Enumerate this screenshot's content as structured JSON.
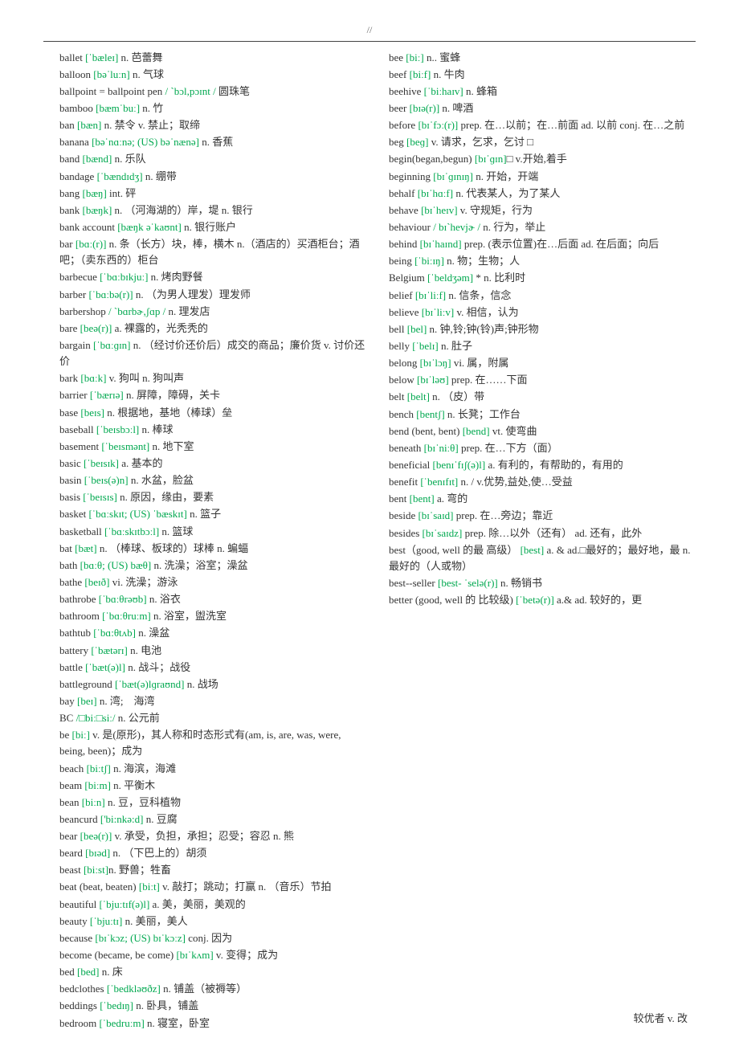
{
  "header": "//",
  "footer_right": "较优者 v. 改",
  "left": [
    {
      "w": "ballet",
      "p": "[ˈbæleɪ]",
      "d": " n. 芭蕾舞"
    },
    {
      "w": "balloon",
      "p": "[bəˈluːn]",
      "d": " n. 气球"
    },
    {
      "w": "ballpoint = ballpoint pen",
      "p": "/ ˋbɔl,pɔɪnt /",
      "d": " 圆珠笔"
    },
    {
      "w": "bamboo",
      "p": "[bæmˈbuː]",
      "d": " n. 竹"
    },
    {
      "w": "ban",
      "p": "[bæn]",
      "d": " n. 禁令 v. 禁止；取缔"
    },
    {
      "w": "banana",
      "p": "[bəˈnɑːnə; (US) bəˈnænə]",
      "d": " n. 香蕉"
    },
    {
      "w": "band",
      "p": "[bænd]",
      "d": " n. 乐队"
    },
    {
      "w": "bandage",
      "p": "[ˈbændɪdʒ]",
      "d": " n. 绷带"
    },
    {
      "w": "bang",
      "p": "[bæŋ]",
      "d": " int. 砰"
    },
    {
      "w": "bank",
      "p": "[bæŋk]",
      "d": " n. （河海湖的）岸，堤  n. 银行"
    },
    {
      "w": "bank account",
      "p": "[bæŋk əˈkaʊnt]",
      "d": " n. 银行账户"
    },
    {
      "w": "bar",
      "p": "[bɑː(r)]",
      "d": " n. 条（长方）块，棒，横木  n.（酒店的）买酒柜台；酒吧；（卖东西的）柜台"
    },
    {
      "w": "barbecue",
      "p": "[ˈbɑːbɪkjuː]",
      "d": " n. 烤肉野餐"
    },
    {
      "w": "barber",
      "p": "[ˈbɑːbə(r)]",
      "d": " n. （为男人理发）理发师"
    },
    {
      "w": "barbershop",
      "p": "/ ˋbɑrbɚ,ʃɑp /",
      "d": " n. 理发店"
    },
    {
      "w": "bare",
      "p": "[beə(r)]",
      "d": " a. 裸露的，光秃秃的"
    },
    {
      "w": "bargain",
      "p": "[ˈbɑːɡɪn]",
      "d": " n. （经讨价还价后）成交的商品；廉价货 v. 讨价还价"
    },
    {
      "w": "bark",
      "p": "[bɑːk]",
      "d": " v. 狗叫  n. 狗叫声"
    },
    {
      "w": "barrier",
      "p": "[ˈbærɪə]",
      "d": " n. 屏障，障碍，关卡"
    },
    {
      "w": "base",
      "p": "[beɪs]",
      "d": " n. 根据地，基地（棒球）垒"
    },
    {
      "w": "baseball",
      "p": "[ˈbeɪsbɔːl]",
      "d": " n. 棒球"
    },
    {
      "w": "basement",
      "p": "[ˈbeɪsmənt]",
      "d": " n. 地下室"
    },
    {
      "w": "basic",
      "p": "[ˈbeɪsɪk]",
      "d": " a. 基本的"
    },
    {
      "w": "basin",
      "p": "[ˈbeɪs(ə)n]",
      "d": " n. 水盆，脸盆"
    },
    {
      "w": "basis",
      "p": "[ˈbeɪsɪs]",
      "d": " n. 原因，缘由，要素"
    },
    {
      "w": "basket",
      "p": "[ˈbɑːskɪt; (US) ˈbæskɪt]",
      "d": " n. 篮子"
    },
    {
      "w": "basketball",
      "p": "[ˈbɑːskɪtbɔːl]",
      "d": " n. 篮球"
    },
    {
      "w": "bat",
      "p": "[bæt]",
      "d": " n. （棒球、板球的）球棒  n. 蝙蝠"
    },
    {
      "w": "bath",
      "p": "[bɑːθ; (US) bæθ]",
      "d": " n. 洗澡；浴室；澡盆"
    },
    {
      "w": "bathe",
      "p": "[beɪð]",
      "d": " vi. 洗澡；游泳"
    },
    {
      "w": "bathrobe",
      "p": "[ˈbɑːθrəʊb]",
      "d": " n. 浴衣"
    },
    {
      "w": "bathroom",
      "p": "[ˈbɑːθruːm]",
      "d": " n. 浴室，盥洗室"
    },
    {
      "w": "bathtub",
      "p": "[ˈbɑ:θtʌb]",
      "d": "    n. 澡盆"
    },
    {
      "w": "battery",
      "p": "[ˈbætərɪ]",
      "d": " n. 电池"
    },
    {
      "w": "battle",
      "p": "[ˈbæt(ə)l]",
      "d": " n. 战斗；战役"
    },
    {
      "w": "battleground",
      "p": "[ˈbæt(ə)lɡraʊnd]",
      "d": " n. 战场"
    },
    {
      "w": "bay",
      "p": "[beɪ]",
      "d": " n. 湾;　海湾"
    },
    {
      "w": "BC",
      "p": "/□biː□siː/",
      "d": " n. 公元前"
    },
    {
      "w": "be",
      "p": "[biː]",
      "d": " v. 是(原形)，其人称和时态形式有(am, is, are, was, were, being, been)；成为"
    },
    {
      "w": "beach",
      "p": "[biːtʃ]",
      "d": " n. 海滨，海滩"
    },
    {
      "w": "beam",
      "p": "[biːm]",
      "d": " n. 平衡木"
    },
    {
      "w": "bean",
      "p": "[biːn]",
      "d": " n. 豆，豆科植物"
    },
    {
      "w": "beancurd",
      "p": "['bi:nkə:d]",
      "d": " n. 豆腐"
    },
    {
      "w": "bear",
      "p": "[beə(r)]",
      "d": " v. 承受，负担，承担；忍受；容忍 n. 熊"
    },
    {
      "w": "beard",
      "p": "[bɪəd]",
      "d": " n. （下巴上的）胡须"
    },
    {
      "w": "beast",
      "p": "[biːst]",
      "d": "n. 野兽；牲畜"
    },
    {
      "w": "beat (beat, beaten)",
      "p": "[biːt]",
      "d": " v. 敲打；跳动；打赢 n. （音乐）节拍"
    },
    {
      "w": "beautiful",
      "p": "[ˈbjuːtɪf(ə)l]",
      "d": " a. 美，美丽，美观的"
    },
    {
      "w": "beauty",
      "p": "[ˈbjuːtɪ]",
      "d": " n. 美丽，美人"
    },
    {
      "w": "because",
      "p": "[bɪˈkɔz; (US) bɪˈkɔːz]",
      "d": " conj. 因为"
    },
    {
      "w": "become (became, be come)",
      "p": "[bɪˈkʌm]",
      "d": " v. 变得；成为"
    },
    {
      "w": "bed",
      "p": "[bed]",
      "d": " n. 床"
    },
    {
      "w": "bedclothes",
      "p": "[ˈbedkləʊðz]",
      "d": " n. 铺盖（被褥等）"
    },
    {
      "w": "beddings",
      "p": "[ˈbedɪŋ]",
      "d": " n. 卧具，铺盖"
    },
    {
      "w": "bedroom",
      "p": "[ˈbedruːm]",
      "d": " n. 寝室，卧室"
    }
  ],
  "right": [
    {
      "w": "bee",
      "p": "[biː]",
      "d": " n.. 蜜蜂"
    },
    {
      "w": "beef",
      "p": "[biːf]",
      "d": " n. 牛肉"
    },
    {
      "w": "beehive",
      "p": "[ˈbiːhaɪv]",
      "d": " n. 蜂箱"
    },
    {
      "w": "beer",
      "p": "[bɪə(r)]",
      "d": " n. 啤酒"
    },
    {
      "w": "before",
      "p": "[bɪˈfɔː(r)]",
      "d": " prep. 在…以前；在…前面 ad. 以前 conj. 在…之前"
    },
    {
      "w": "beg",
      "p": "[beɡ]",
      "d": " v. 请求，乞求，乞讨 □"
    },
    {
      "w": "begin(began,begun)",
      "p": "[bɪˈɡɪn]",
      "d": "□ v.开始,着手"
    },
    {
      "w": "beginning",
      "p": "[bɪˈɡɪnɪŋ]",
      "d": " n. 开始，开端"
    },
    {
      "w": "behalf",
      "p": "[bɪˈhɑːf]",
      "d": " n. 代表某人，为了某人"
    },
    {
      "w": "behave",
      "p": "[bɪˈheɪv]",
      "d": " v. 守规矩，行为"
    },
    {
      "w": "behaviour",
      "p": "/ bɪˋhevjɚ /",
      "d": "    n. 行为，举止"
    },
    {
      "w": "behind",
      "p": "[bɪˈhaɪnd]",
      "d": " prep. (表示位置)在…后面 ad. 在后面；向后"
    },
    {
      "w": "being",
      "p": "[ˈbiːɪŋ]",
      "d": " n. 物；生物；人"
    },
    {
      "w": "Belgium",
      "p": "[ˈbeldʒəm]",
      "d": " * n. 比利时"
    },
    {
      "w": "belief",
      "p": "[bɪˈliːf]",
      "d": " n. 信条，信念"
    },
    {
      "w": "believe",
      "p": "[bɪˈliːv]",
      "d": " v. 相信，认为"
    },
    {
      "w": "bell",
      "p": "[bel]",
      "d": " n. 钟,铃;钟(铃)声;钟形物"
    },
    {
      "w": "belly",
      "p": "[ˈbelɪ]",
      "d": " n. 肚子"
    },
    {
      "w": "belong",
      "p": "[bɪˈlɔŋ]",
      "d": " vi. 属，附属"
    },
    {
      "w": "below",
      "p": "[bɪˈləʊ]",
      "d": " prep. 在……下面"
    },
    {
      "w": "belt",
      "p": "[belt]",
      "d": " n. （皮）带"
    },
    {
      "w": "bench",
      "p": "[bentʃ]",
      "d": " n. 长凳；工作台"
    },
    {
      "w": "bend (bent, bent)",
      "p": "[bend]",
      "d": " vt. 使弯曲"
    },
    {
      "w": "beneath",
      "p": "[bɪˈniːθ]",
      "d": " prep. 在…下方（面）"
    },
    {
      "w": "beneficial",
      "p": "[benɪˈfɪʃ(ə)l]",
      "d": " a. 有利的，有帮助的，有用的"
    },
    {
      "w": "benefit",
      "p": "[ˈbenɪfɪt]",
      "d": " n. / v.优势,益处,使…受益"
    },
    {
      "w": "bent",
      "p": "[bent]",
      "d": " a. 弯的"
    },
    {
      "w": "beside",
      "p": "[bɪˈsaɪd]",
      "d": " prep. 在…旁边；靠近"
    },
    {
      "w": "besides",
      "p": "[bɪˈsaɪdz]",
      "d": " prep. 除…以外（还有）  ad. 还有，此外"
    },
    {
      "w": "best（good, well 的最 高级）",
      "p": "[best]",
      "d": " a. & ad.□最好的；最好地，最 n. 最好的（人或物）"
    },
    {
      "w": "best--seller",
      "p": "[best- ˈselə(r)]",
      "d": " n. 畅销书"
    },
    {
      "w": "better (good, well 的 比较级)",
      "p": "[ˈbetə(r)]",
      "d": " a.& ad. 较好的，更"
    }
  ]
}
